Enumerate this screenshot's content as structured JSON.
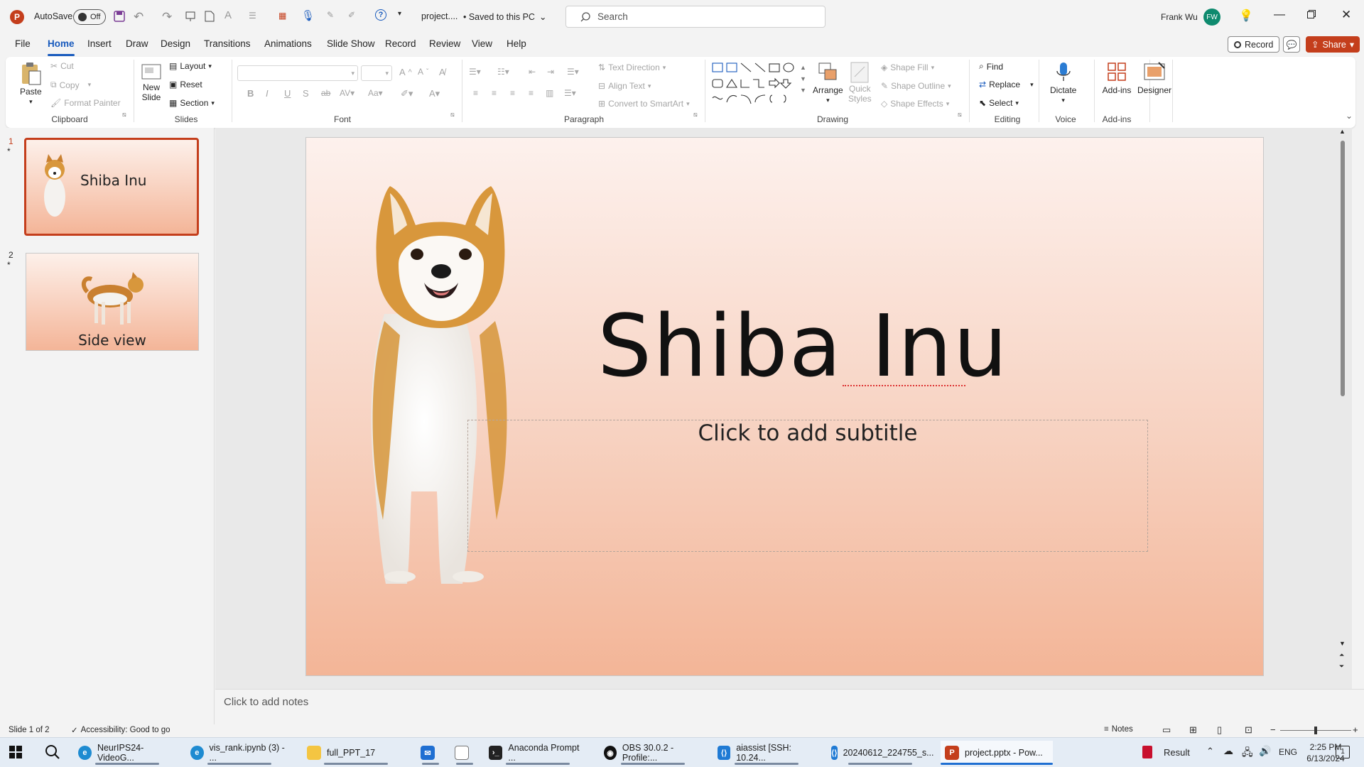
{
  "titlebar": {
    "autosave_label": "AutoSave",
    "autosave_state": "Off",
    "file_name": "project....",
    "save_status": "• Saved to this PC",
    "search_placeholder": "Search",
    "user_name": "Frank Wu",
    "user_initials": "FW"
  },
  "menu": {
    "tabs": [
      "File",
      "Home",
      "Insert",
      "Draw",
      "Design",
      "Transitions",
      "Animations",
      "Slide Show",
      "Record",
      "Review",
      "View",
      "Help"
    ],
    "record_button": "Record",
    "share_button": "Share"
  },
  "ribbon": {
    "clipboard": {
      "paste": "Paste",
      "cut": "Cut",
      "copy": "Copy",
      "format_painter": "Format Painter",
      "group": "Clipboard"
    },
    "slides": {
      "new_slide": [
        "New",
        "Slide"
      ],
      "layout": "Layout",
      "reset": "Reset",
      "section": "Section",
      "group": "Slides"
    },
    "font": {
      "group": "Font"
    },
    "paragraph": {
      "text_direction": "Text Direction",
      "align_text": "Align Text",
      "convert_smartart": "Convert to SmartArt",
      "group": "Paragraph"
    },
    "drawing": {
      "arrange": "Arrange",
      "quick_styles": [
        "Quick",
        "Styles"
      ],
      "shape_fill": "Shape Fill",
      "shape_outline": "Shape Outline",
      "shape_effects": "Shape Effects",
      "group": "Drawing"
    },
    "editing": {
      "find": "Find",
      "replace": "Replace",
      "select": "Select",
      "group": "Editing"
    },
    "voice": {
      "dictate": "Dictate",
      "group": "Voice"
    },
    "addins": {
      "addins": "Add-ins",
      "group": "Add-ins"
    },
    "designer": {
      "designer": "Designer"
    }
  },
  "slides_panel": {
    "items": [
      {
        "number": "1",
        "star": "*",
        "title": "Shiba Inu"
      },
      {
        "number": "2",
        "star": "*",
        "title": "Side view"
      }
    ]
  },
  "slide": {
    "title": "Shiba Inu",
    "subtitle_placeholder": "Click to add subtitle"
  },
  "notes": {
    "placeholder": "Click to add notes"
  },
  "statusbar": {
    "slide_info": "Slide 1 of 2",
    "accessibility": "Accessibility: Good to go",
    "notes_button": "Notes"
  },
  "taskbar": {
    "items": [
      "NeurIPS24-VideoG...",
      "vis_rank.ipynb (3) - ...",
      "full_PPT_17",
      "",
      "",
      "Anaconda Prompt ...",
      "OBS 30.0.2 - Profile:...",
      "aiassist [SSH: 10.24...",
      "20240612_224755_s...",
      "project.pptx - Pow..."
    ],
    "result": "Result",
    "lang": "ENG",
    "time": "2:25 PM",
    "date": "6/13/2024",
    "notif_count": "1"
  },
  "colors": {
    "accent": "#185abd",
    "brand_ppt": "#c43e1c",
    "share": "#c43e1c"
  }
}
